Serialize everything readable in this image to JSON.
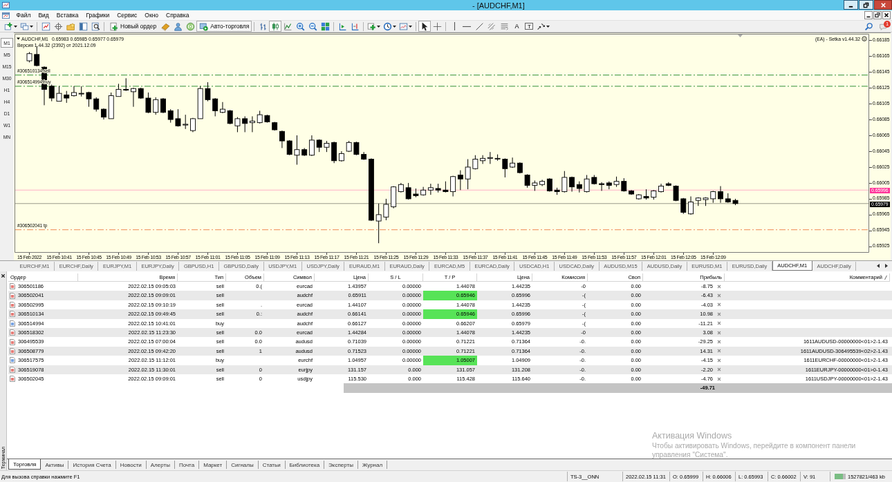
{
  "window": {
    "title": "- [AUDCHF,M1]"
  },
  "menu": {
    "items": [
      "Файл",
      "Вид",
      "Вставка",
      "Графики",
      "Сервис",
      "Окно",
      "Справка"
    ]
  },
  "toolbar": {
    "new_order": "Новый ордер",
    "autotrading": "Авто-торговля",
    "chart_modes": [
      {
        "selected": false
      },
      {
        "selected": true
      },
      {
        "selected": false
      }
    ],
    "cursor_modes": [
      {
        "selected": true
      },
      {
        "selected": false
      }
    ],
    "text_tool": "A",
    "label_tool": "T",
    "notifications": "1"
  },
  "timeframes": [
    {
      "label": "M1",
      "selected": true
    },
    {
      "label": "M5",
      "selected": false
    },
    {
      "label": "M15",
      "selected": false
    },
    {
      "label": "M30",
      "selected": false
    },
    {
      "label": "H1",
      "selected": false
    },
    {
      "label": "H4",
      "selected": false
    },
    {
      "label": "D1",
      "selected": false
    },
    {
      "label": "W1",
      "selected": false
    },
    {
      "label": "MN",
      "selected": false
    }
  ],
  "chart": {
    "symbol": "AUDCHF,M1",
    "quotes": "0.65983 0.65985 0.65977 0.65979",
    "version": "Версия 1.44.32 (2392) от 2021.12.09",
    "expert": "(EA) - Setka v1.44.32",
    "chart_data": [
      {
        "type": "candlestick",
        "x": [
          "2022-02-15T10:37",
          "2022-02-15T10:38",
          "2022-02-15T10:39",
          "2022-02-15T10:40",
          "2022-02-15T10:41",
          "2022-02-15T10:42",
          "2022-02-15T10:43",
          "2022-02-15T10:44",
          "2022-02-15T10:45",
          "2022-02-15T10:46",
          "2022-02-15T10:47",
          "2022-02-15T10:48",
          "2022-02-15T10:49",
          "2022-02-15T10:50",
          "2022-02-15T10:51",
          "2022-02-15T10:52",
          "2022-02-15T10:53",
          "2022-02-15T10:54",
          "2022-02-15T10:55",
          "2022-02-15T10:56",
          "2022-02-15T10:57",
          "2022-02-15T10:58",
          "2022-02-15T10:59",
          "2022-02-15T11:00",
          "2022-02-15T11:01",
          "2022-02-15T11:02",
          "2022-02-15T11:03",
          "2022-02-15T11:04",
          "2022-02-15T11:05",
          "2022-02-15T11:06",
          "2022-02-15T11:07",
          "2022-02-15T11:08",
          "2022-02-15T11:09",
          "2022-02-15T11:10",
          "2022-02-15T11:11",
          "2022-02-15T11:12",
          "2022-02-15T11:13",
          "2022-02-15T11:14",
          "2022-02-15T11:15",
          "2022-02-15T11:16",
          "2022-02-15T11:17",
          "2022-02-15T11:18",
          "2022-02-15T11:19",
          "2022-02-15T11:20",
          "2022-02-15T11:21",
          "2022-02-15T11:22",
          "2022-02-15T11:23",
          "2022-02-15T11:24",
          "2022-02-15T11:25",
          "2022-02-15T11:26",
          "2022-02-15T11:27",
          "2022-02-15T11:28",
          "2022-02-15T11:29",
          "2022-02-15T11:30",
          "2022-02-15T11:31",
          "2022-02-15T11:32",
          "2022-02-15T11:33",
          "2022-02-15T11:34",
          "2022-02-15T11:35",
          "2022-02-15T11:36",
          "2022-02-15T11:37",
          "2022-02-15T11:38",
          "2022-02-15T11:39",
          "2022-02-15T11:40",
          "2022-02-15T11:41",
          "2022-02-15T11:42",
          "2022-02-15T11:43",
          "2022-02-15T11:44",
          "2022-02-15T11:45",
          "2022-02-15T11:46",
          "2022-02-15T11:47",
          "2022-02-15T11:48",
          "2022-02-15T11:49",
          "2022-02-15T11:50",
          "2022-02-15T11:51",
          "2022-02-15T11:52",
          "2022-02-15T11:53",
          "2022-02-15T11:54",
          "2022-02-15T11:55",
          "2022-02-15T11:56",
          "2022-02-15T11:57",
          "2022-02-15T11:58",
          "2022-02-15T11:59",
          "2022-02-15T12:00",
          "2022-02-15T12:01",
          "2022-02-15T12:02",
          "2022-02-15T12:03",
          "2022-02-15T12:04",
          "2022-02-15T12:05",
          "2022-02-15T12:06",
          "2022-02-15T12:07",
          "2022-02-15T12:08",
          "2022-02-15T12:09",
          "2022-02-15T12:10",
          "2022-02-15T12:11",
          "2022-02-15T12:12"
        ],
        "ohlc": [
          [
            0.66159,
            0.6617,
            0.66157,
            0.66168
          ],
          [
            0.66167,
            0.66177,
            0.66152,
            0.66153
          ],
          [
            0.66151,
            0.66152,
            0.66103,
            0.66123
          ],
          [
            0.66127,
            0.66129,
            0.66108,
            0.66112
          ],
          [
            0.66108,
            0.66127,
            0.66108,
            0.66118
          ],
          [
            0.66116,
            0.66121,
            0.66106,
            0.66112
          ],
          [
            0.66115,
            0.66127,
            0.66114,
            0.66119
          ],
          [
            0.66118,
            0.66127,
            0.66114,
            0.66118
          ],
          [
            0.66119,
            0.6612,
            0.66101,
            0.66111
          ],
          [
            0.66111,
            0.66113,
            0.66095,
            0.66098
          ],
          [
            0.66098,
            0.66099,
            0.66085,
            0.66088
          ],
          [
            0.66086,
            0.66119,
            0.66086,
            0.66115
          ],
          [
            0.66114,
            0.6613,
            0.66114,
            0.66123
          ],
          [
            0.66123,
            0.66137,
            0.66121,
            0.66122
          ],
          [
            0.6612,
            0.66125,
            0.66101,
            0.66124
          ],
          [
            0.66124,
            0.66125,
            0.66111,
            0.66112
          ],
          [
            0.66112,
            0.66119,
            0.66093,
            0.66094
          ],
          [
            0.66094,
            0.66113,
            0.66091,
            0.6611
          ],
          [
            0.66111,
            0.66112,
            0.66093,
            0.66094
          ],
          [
            0.66096,
            0.66098,
            0.66081,
            0.66085
          ],
          [
            0.66086,
            0.66098,
            0.66076,
            0.66077
          ],
          [
            0.66078,
            0.66091,
            0.66073,
            0.66079
          ],
          [
            0.66071,
            0.66087,
            0.66069,
            0.66086
          ],
          [
            0.66086,
            0.66127,
            0.66086,
            0.66124
          ],
          [
            0.66124,
            0.66132,
            0.66108,
            0.6611
          ],
          [
            0.66111,
            0.66112,
            0.66089,
            0.66096
          ],
          [
            0.66094,
            0.66107,
            0.66093,
            0.66098
          ],
          [
            0.66096,
            0.66097,
            0.66079,
            0.6608
          ],
          [
            0.66077,
            0.66088,
            0.66069,
            0.66086
          ],
          [
            0.66086,
            0.66089,
            0.66069,
            0.6608
          ],
          [
            0.66081,
            0.66089,
            0.66069,
            0.66083
          ],
          [
            0.66081,
            0.66096,
            0.6608,
            0.66091
          ],
          [
            0.6609,
            0.66091,
            0.66081,
            0.66082
          ],
          [
            0.66081,
            0.66082,
            0.66071,
            0.66072
          ],
          [
            0.6607,
            0.66071,
            0.66049,
            0.66058
          ],
          [
            0.66058,
            0.66059,
            0.6604,
            0.66041
          ],
          [
            0.6604,
            0.66065,
            0.66028,
            0.66047
          ],
          [
            0.66047,
            0.66049,
            0.66039,
            0.6604
          ],
          [
            0.6604,
            0.66065,
            0.66039,
            0.66059
          ],
          [
            0.66059,
            0.6606,
            0.66044,
            0.6605
          ],
          [
            0.6605,
            0.66058,
            0.66044,
            0.66055
          ],
          [
            0.66056,
            0.66057,
            0.6603,
            0.66033
          ],
          [
            0.66033,
            0.66045,
            0.66032,
            0.66042
          ],
          [
            0.66045,
            0.66058,
            0.66044,
            0.66056
          ],
          [
            0.66056,
            0.66057,
            0.6604,
            0.66041
          ],
          [
            0.66041,
            0.66044,
            0.66034,
            0.66035
          ],
          [
            0.66035,
            0.66036,
            0.65957,
            0.65958
          ],
          [
            0.65957,
            0.65979,
            0.65929,
            0.65965
          ],
          [
            0.65962,
            0.65985,
            0.65958,
            0.65978
          ],
          [
            0.65975,
            0.66001,
            0.65973,
            0.66
          ],
          [
            0.65994,
            0.66005,
            0.65993,
            0.66003
          ],
          [
            0.65999,
            0.66005,
            0.65984,
            0.65985
          ],
          [
            0.65991,
            0.65998,
            0.65987,
            0.65989
          ],
          [
            0.6599,
            0.66,
            0.65989,
            0.65996
          ],
          [
            0.65996,
            0.66004,
            0.6599,
            0.65999
          ],
          [
            0.65998,
            0.66004,
            0.65993,
            0.65996
          ],
          [
            0.65996,
            0.66007,
            0.65993,
            0.65994
          ],
          [
            0.65994,
            0.66014,
            0.65988,
            0.66013
          ],
          [
            0.66015,
            0.66021,
            0.65996,
            0.6601
          ],
          [
            0.6601,
            0.66035,
            0.65997,
            0.66025
          ],
          [
            0.66023,
            0.6604,
            0.66022,
            0.66035
          ],
          [
            0.66033,
            0.6604,
            0.66029,
            0.66036
          ],
          [
            0.66036,
            0.66044,
            0.66029,
            0.66037
          ],
          [
            0.66036,
            0.66041,
            0.66033,
            0.66036
          ],
          [
            0.66035,
            0.66036,
            0.66012,
            0.66023
          ],
          [
            0.66025,
            0.66037,
            0.66024,
            0.6603
          ],
          [
            0.6603,
            0.66031,
            0.66017,
            0.66018
          ],
          [
            0.66015,
            0.66016,
            0.65999,
            0.66002
          ],
          [
            0.66002,
            0.66008,
            0.65995,
            0.66005
          ],
          [
            0.66003,
            0.66009,
            0.66001,
            0.66007
          ],
          [
            0.6601,
            0.66011,
            0.65994,
            0.65995
          ],
          [
            0.65996,
            0.65999,
            0.6599,
            0.65994
          ],
          [
            0.65994,
            0.6602,
            0.65993,
            0.66012
          ],
          [
            0.66012,
            0.66013,
            0.65994,
            0.66
          ],
          [
            0.66003,
            0.66007,
            0.65993,
            0.65998
          ],
          [
            0.65994,
            0.66015,
            0.65993,
            0.6601
          ],
          [
            0.66012,
            0.66015,
            0.66003,
            0.66004
          ],
          [
            0.66004,
            0.66006,
            0.65995,
            0.66003
          ],
          [
            0.66005,
            0.66007,
            0.65997,
            0.66002
          ],
          [
            0.66003,
            0.66013,
            0.66,
            0.66007
          ],
          [
            0.66007,
            0.66011,
            0.65994,
            0.65995
          ],
          [
            0.65995,
            0.65996,
            0.6599,
            0.65991
          ],
          [
            0.65985,
            0.65991,
            0.65984,
            0.6599
          ],
          [
            0.65988,
            0.65997,
            0.65984,
            0.65986
          ],
          [
            0.65987,
            0.65996,
            0.65984,
            0.65995
          ],
          [
            0.65994,
            0.66004,
            0.65993,
            0.66001
          ],
          [
            0.66004,
            0.66006,
            0.66001,
            0.66002
          ],
          [
            0.66001,
            0.66002,
            0.65982,
            0.65983
          ],
          [
            0.65985,
            0.65986,
            0.65966,
            0.65968
          ],
          [
            0.65966,
            0.65988,
            0.65965,
            0.65981
          ],
          [
            0.65983,
            0.65987,
            0.65976,
            0.65986
          ],
          [
            0.65984,
            0.65987,
            0.65976,
            0.65986
          ],
          [
            0.65985,
            0.65995,
            0.6598,
            0.65994
          ],
          [
            0.65994,
            0.66001,
            0.6598,
            0.65985
          ],
          [
            0.65985,
            0.65992,
            0.6598,
            0.65981
          ],
          [
            0.65983,
            0.65985,
            0.65977,
            0.65979
          ]
        ],
        "xlim": [
          "2022-02-15T10:35",
          "2022-02-15T12:30"
        ],
        "xticks": [
          {
            "value": "2022-02-15T10:37",
            "label": "15 Feb 2022"
          },
          {
            "value": "2022-02-15T10:41",
            "label": "15 Feb 10:41"
          },
          {
            "value": "2022-02-15T10:45",
            "label": "15 Feb 10:45"
          },
          {
            "value": "2022-02-15T10:49",
            "label": "15 Feb 10:49"
          },
          {
            "value": "2022-02-15T10:53",
            "label": "15 Feb 10:53"
          },
          {
            "value": "2022-02-15T10:57",
            "label": "15 Feb 10:57"
          },
          {
            "value": "2022-02-15T11:01",
            "label": "15 Feb 11:01"
          },
          {
            "value": "2022-02-15T11:05",
            "label": "15 Feb 11:05"
          },
          {
            "value": "2022-02-15T11:09",
            "label": "15 Feb 11:09"
          },
          {
            "value": "2022-02-15T11:13",
            "label": "15 Feb 11:13"
          },
          {
            "value": "2022-02-15T11:17",
            "label": "15 Feb 11:17"
          },
          {
            "value": "2022-02-15T11:21",
            "label": "15 Feb 11:21"
          },
          {
            "value": "2022-02-15T11:25",
            "label": "15 Feb 11:25"
          },
          {
            "value": "2022-02-15T11:29",
            "label": "15 Feb 11:29"
          },
          {
            "value": "2022-02-15T11:33",
            "label": "15 Feb 11:33"
          },
          {
            "value": "2022-02-15T11:37",
            "label": "15 Feb 11:37"
          },
          {
            "value": "2022-02-15T11:41",
            "label": "15 Feb 11:41"
          },
          {
            "value": "2022-02-15T11:45",
            "label": "15 Feb 11:45"
          },
          {
            "value": "2022-02-15T11:49",
            "label": "15 Feb 11:49"
          },
          {
            "value": "2022-02-15T11:53",
            "label": "15 Feb 11:53"
          },
          {
            "value": "2022-02-15T11:57",
            "label": "15 Feb 11:57"
          },
          {
            "value": "2022-02-15T12:01",
            "label": "15 Feb 12:01"
          },
          {
            "value": "2022-02-15T12:05",
            "label": "15 Feb 12:05"
          },
          {
            "value": "2022-02-15T12:09",
            "label": "15 Feb 12:09"
          }
        ],
        "yticks": [
          0.65925,
          0.65945,
          0.65965,
          0.65985,
          0.66005,
          0.66025,
          0.66045,
          0.66065,
          0.66085,
          0.66105,
          0.66125,
          0.66145,
          0.66165,
          0.66185
        ],
        "ylim": [
          0.65917,
          0.66193
        ],
        "ref_lines": [
          {
            "axis": "y",
            "value": 0.66141,
            "label": "#306510134 sell",
            "color": "#5aa65a",
            "line_style": "dashdot"
          },
          {
            "axis": "y",
            "value": 0.66127,
            "label": "#306514994 buy",
            "color": "#5aa65a",
            "line_style": "dashdot"
          },
          {
            "axis": "y",
            "value": 0.65996,
            "label": "0.65996",
            "color": "#ff3399",
            "line_style": "solid"
          },
          {
            "axis": "y",
            "value": 0.65979,
            "label": "0.65979",
            "color": "#000000",
            "line_style": "solid"
          },
          {
            "axis": "y",
            "value": 0.65946,
            "label": "#306502041 tp",
            "color": "#f2a070",
            "line_style": "dashdot"
          }
        ]
      }
    ]
  },
  "chart_tabs": [
    {
      "label": "EURCHF,M1",
      "selected": false
    },
    {
      "label": "EURCHF,Daily",
      "selected": false
    },
    {
      "label": "EURJPY,M1",
      "selected": false
    },
    {
      "label": "EURJPY,Daily",
      "selected": false
    },
    {
      "label": "GBPUSD,H1",
      "selected": false
    },
    {
      "label": "GBPUSD,Daily",
      "selected": false
    },
    {
      "label": "USDJPY,M1",
      "selected": false
    },
    {
      "label": "USDJPY,Daily",
      "selected": false
    },
    {
      "label": "EURAUD,M1",
      "selected": false
    },
    {
      "label": "EURAUD,Daily",
      "selected": false
    },
    {
      "label": "EURCAD,M5",
      "selected": false
    },
    {
      "label": "EURCAD,Daily",
      "selected": false
    },
    {
      "label": "USDCAD,H1",
      "selected": false
    },
    {
      "label": "USDCAD,Daily",
      "selected": false
    },
    {
      "label": "AUDUSD,M15",
      "selected": false
    },
    {
      "label": "AUDUSD,Daily",
      "selected": false
    },
    {
      "label": "EURUSD,M1",
      "selected": false
    },
    {
      "label": "EURUSD,Daily",
      "selected": false
    },
    {
      "label": "AUDCHF,M1",
      "selected": true
    },
    {
      "label": "AUDCHF,Daily",
      "selected": false
    }
  ],
  "terminal": {
    "title": "Терминал",
    "columns": [
      "Ордер",
      "Время",
      "Тип",
      "Объем",
      "Символ",
      "Цена",
      "S / L",
      "T / P",
      "Цена",
      "Комиссия",
      "Своп",
      "Прибыль",
      "Комментарий"
    ],
    "rows": [
      {
        "kind": "sell",
        "order": "306501186",
        "time": "2022.02.15 09:05:03",
        "type": "sell",
        "volume": "0.(",
        "symbol": "eurcad",
        "price": "1.43957",
        "sl": "0.00000",
        "tp": "1.44078",
        "tp_highlight": false,
        "current_price": "1.44235",
        "commission": "-0",
        "swap": "0.00",
        "profit": "-8.75"
      },
      {
        "kind": "sell",
        "order": "306502041",
        "time": "2022.02.15 09:09:01",
        "type": "sell",
        "symbol": "audchf",
        "price": "0.65911",
        "sl": "0.00000",
        "tp": "0.65946",
        "tp_highlight": true,
        "current_price": "0.65996",
        "commission": "-(",
        "swap": "0.00",
        "profit": "-6.43"
      },
      {
        "kind": "sell",
        "order": "306502995",
        "time": "2022.02.15 09:10:19",
        "type": "sell",
        "volume": ".",
        "symbol": "eurcad",
        "price": "1.44107",
        "sl": "0.00000",
        "tp": "1.44078",
        "tp_highlight": false,
        "current_price": "1.44235",
        "commission": "-(",
        "swap": "0.00",
        "profit": "-4.03"
      },
      {
        "kind": "sell",
        "order": "306510134",
        "time": "2022.02.15 09:49:45",
        "type": "sell",
        "volume": "0.:",
        "symbol": "audchf",
        "price": "0.66141",
        "sl": "0.00000",
        "tp": "0.65946",
        "tp_highlight": true,
        "current_price": "0.65996",
        "commission": "-(",
        "swap": "0.00",
        "profit": "10.98"
      },
      {
        "kind": "buy",
        "order": "306514994",
        "time": "2022.02.15 10:41:01",
        "type": "buy",
        "symbol": "audchf",
        "price": "0.66127",
        "sl": "0.00000",
        "tp": "0.66207",
        "tp_highlight": false,
        "current_price": "0.65979",
        "commission": "-(",
        "swap": "0.00",
        "profit": "-11.21"
      },
      {
        "kind": "sell",
        "order": "306518302",
        "time": "2022.02.15 11:23:30",
        "type": "sell",
        "volume": "0.0",
        "symbol": "eurcad",
        "price": "1.44284",
        "sl": "0.00000",
        "tp": "1.44078",
        "tp_highlight": false,
        "current_price": "1.44235",
        "commission": "-0",
        "swap": "0.00",
        "profit": "3.08"
      },
      {
        "kind": "sell",
        "order": "306495539",
        "time": "2022.02.15 07:00:04",
        "type": "sell",
        "volume": "0.0",
        "symbol": "audusd",
        "price": "0.71039",
        "sl": "0.00000",
        "tp": "0.71221",
        "tp_highlight": false,
        "current_price": "0.71364",
        "commission": "-0.",
        "swap": "0.00",
        "profit": "-29.25",
        "comment": "1611AUDUSD-00000000<01>2-1.43"
      },
      {
        "kind": "sell",
        "order": "306508779",
        "time": "2022.02.15 09:42:20",
        "type": "sell",
        "volume": "1",
        "symbol": "audusd",
        "price": "0.71523",
        "sl": "0.00000",
        "tp": "0.71221",
        "tp_highlight": false,
        "current_price": "0.71364",
        "commission": "-0.",
        "swap": "0.00",
        "profit": "14.31",
        "comment": "1611AUDUSD-306495539<02>2-1.43"
      },
      {
        "kind": "buy",
        "order": "306517575",
        "time": "2022.02.15 11:12:01",
        "type": "buy",
        "symbol": "eurchf",
        "price": "1.04957",
        "sl": "0.00000",
        "tp": "1.05007",
        "tp_highlight": true,
        "current_price": "1.04909",
        "commission": "-0.",
        "swap": "0.00",
        "profit": "-4.15",
        "comment": "1611EURCHF-00000000<01>2-1.43"
      },
      {
        "kind": "sell",
        "order": "306519078",
        "time": "2022.02.15 11:30:01",
        "type": "sell",
        "volume": "0",
        "symbol": "eurjpy",
        "price": "131.157",
        "sl": "0.000",
        "tp": "131.057",
        "tp_highlight": false,
        "current_price": "131.208",
        "commission": "-0.",
        "swap": "0.00",
        "profit": "-2.20",
        "comment": "1611EURJPY-00000000<01>0-1.43"
      },
      {
        "kind": "sell",
        "order": "306502045",
        "time": "2022.02.15 09:09:01",
        "type": "sell",
        "volume": "0",
        "symbol": "usdjpy",
        "price": "115.530",
        "sl": "0.000",
        "tp": "115.428",
        "tp_highlight": false,
        "current_price": "115.640",
        "commission": "-0.",
        "swap": "0.00",
        "profit": "-4.76",
        "comment": "1611USDJPY-00000000<01>2-1.43"
      }
    ],
    "total": "-49.71",
    "tabs": [
      {
        "label": "Торговля",
        "selected": true
      },
      {
        "label": "Активы",
        "selected": false
      },
      {
        "label": "История Счета",
        "selected": false
      },
      {
        "label": "Новости",
        "selected": false
      },
      {
        "label": "Алерты",
        "selected": false
      },
      {
        "label": "Почта",
        "selected": false
      },
      {
        "label": "Маркет",
        "selected": false
      },
      {
        "label": "Сигналы",
        "selected": false
      },
      {
        "label": "Статьи",
        "selected": false
      },
      {
        "label": "Библиотека",
        "selected": false
      },
      {
        "label": "Эксперты",
        "selected": false
      },
      {
        "label": "Журнал",
        "selected": false
      }
    ]
  },
  "activation_notice": {
    "title": "Активация Windows",
    "text": "Чтобы активировать Windows, перейдите в компонент панели управления \"Система\"."
  },
  "status_bar": {
    "help": "Для вызова справки нажмите F1",
    "profile": "TS-3__ONN",
    "datetime": "2022.02.15 11:31",
    "open": "O: 0.65999",
    "high": "H: 0.66006",
    "low": "L: 0.65993",
    "close": "C: 0.66002",
    "volume": "V: 91",
    "traffic": "1527821/463 kb"
  }
}
